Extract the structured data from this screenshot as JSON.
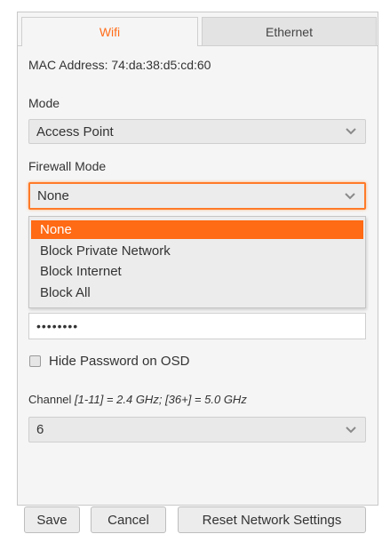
{
  "tabs": {
    "wifi": "Wifi",
    "ethernet": "Ethernet"
  },
  "mac": "MAC Address: 74:da:38:d5:cd:60",
  "mode": {
    "label": "Mode",
    "value": "Access Point"
  },
  "firewall": {
    "label": "Firewall Mode",
    "value": "None",
    "options": [
      "None",
      "Block Private Network",
      "Block Internet",
      "Block All"
    ]
  },
  "password": {
    "value": "••••••••"
  },
  "hide_password": {
    "label": "Hide Password on OSD",
    "checked": false
  },
  "channel": {
    "label": "Channel ",
    "hint": "[1-11] = 2.4 GHz; [36+] = 5.0 GHz",
    "value": "6"
  },
  "buttons": {
    "save": "Save",
    "cancel": "Cancel",
    "reset": "Reset Network Settings"
  },
  "colors": {
    "accent": "#ff6a14",
    "panel_bg": "#f5f5f5"
  }
}
